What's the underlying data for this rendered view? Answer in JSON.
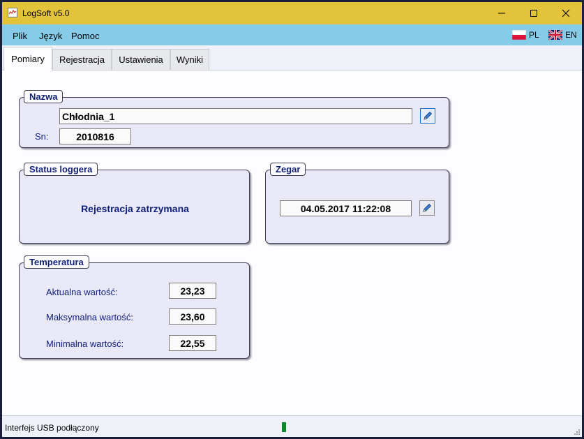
{
  "window": {
    "title": "LogSoft v5.0",
    "accent_color": "#e3c33a",
    "controls": [
      "minimize-icon",
      "maximize-icon",
      "close-icon"
    ]
  },
  "menu": {
    "items": [
      "Plik",
      "Język",
      "Pomoc"
    ],
    "bar_color": "#86cce8",
    "languages": [
      {
        "code": "PL",
        "flag": "flag-pl-icon"
      },
      {
        "code": "EN",
        "flag": "flag-uk-icon"
      }
    ]
  },
  "tabs": [
    {
      "label": "Pomiary",
      "active": true
    },
    {
      "label": "Rejestracja",
      "active": false
    },
    {
      "label": "Ustawienia",
      "active": false
    },
    {
      "label": "Wyniki",
      "active": false
    }
  ],
  "nazwa": {
    "title": "Nazwa",
    "name_value": "Chłodnia_1",
    "sn_label": "Sn:",
    "sn_value": "2010816",
    "edit_icon": "pencil-icon"
  },
  "status_loggera": {
    "title": "Status loggera",
    "text": "Rejestracja zatrzymana"
  },
  "zegar": {
    "title": "Zegar",
    "datetime": "04.05.2017 11:22:08",
    "edit_icon": "pencil-icon"
  },
  "temperatura": {
    "title": "Temperatura",
    "rows": [
      {
        "label": "Aktualna wartość:",
        "value": "23,23"
      },
      {
        "label": "Maksymalna wartość:",
        "value": "23,60"
      },
      {
        "label": "Minimalna wartość:",
        "value": "22,55"
      }
    ]
  },
  "statusbar": {
    "text": "Interfejs USB podłączony",
    "usb_indicator_color": "#0a8a2c"
  }
}
